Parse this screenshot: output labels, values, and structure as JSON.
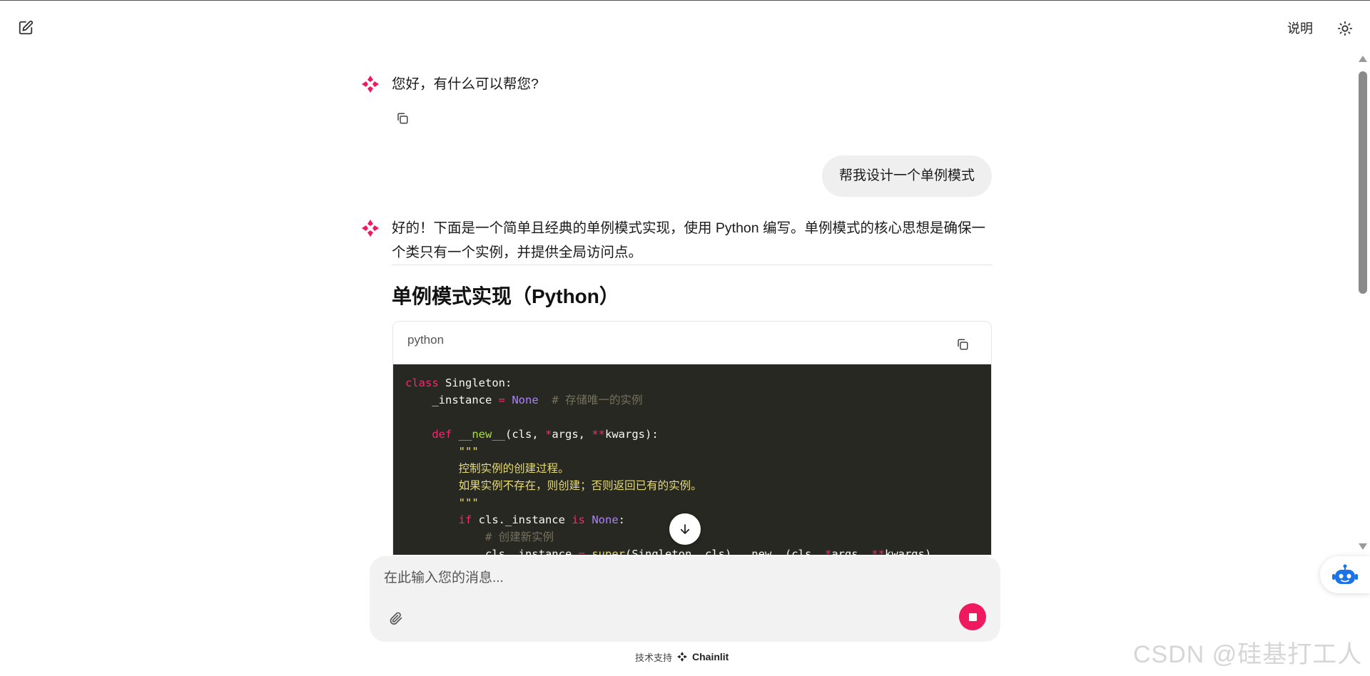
{
  "header": {
    "readme_label": "说明"
  },
  "messages": {
    "greeting": "您好，有什么可以帮您?",
    "user_request": "帮我设计一个单例模式",
    "reply_intro_line1": "好的！下面是一个简单且经典的单例模式实现，使用 Python 编写。单例模式的核心思想是确保一",
    "reply_intro_line2": "个类只有一个实例，并提供全局访问点。",
    "section_heading": "单例模式实现（Python）"
  },
  "code_block": {
    "language": "python",
    "lines": [
      "class Singleton:",
      "    _instance = None  # 存储唯一的实例",
      "",
      "    def __new__(cls, *args, **kwargs):",
      "        \"\"\"",
      "        控制实例的创建过程。",
      "        如果实例不存在，则创建；否则返回已有的实例。",
      "        \"\"\"",
      "        if cls._instance is None:",
      "            # 创建新实例",
      "            cls._instance = super(Singleton, cls).__new__(cls, *args, **kwargs)"
    ]
  },
  "composer": {
    "placeholder": "在此输入您的消息..."
  },
  "footer": {
    "powered_by": "技术支持",
    "brand": "Chainlit"
  },
  "watermark": "CSDN @硅基打工人",
  "icons": {
    "new_chat": "edit-icon",
    "theme": "sun-icon",
    "copy": "copy-icon",
    "attach": "paperclip-icon",
    "stop": "stop-icon",
    "scroll_down": "arrow-down-icon",
    "bot_avatar": "chainlit-logo-icon",
    "widget": "robot-icon"
  },
  "colors": {
    "accent": "#f0185f",
    "code_bg": "#272822",
    "user_bubble": "#efefef",
    "composer_bg": "#f2f2f2"
  }
}
